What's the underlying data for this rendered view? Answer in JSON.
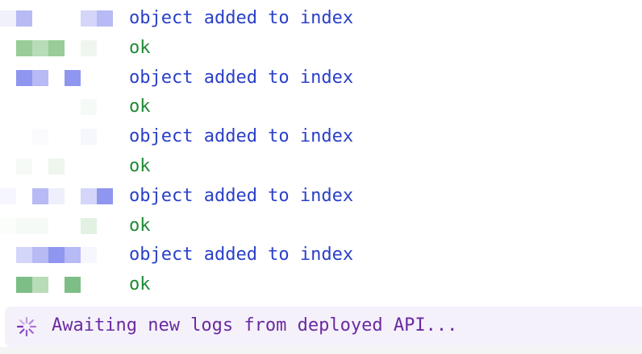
{
  "colors": {
    "message": "#2a40c8",
    "ok": "#1f8a34",
    "status_text": "#6a2aa0",
    "status_bg": "#f5f1fb",
    "spinner": "#7a33b8"
  },
  "log_lines": [
    {
      "text": "object added to index",
      "kind": "message",
      "blocks": [
        [
          "#f1f1fb",
          "#b7baf4",
          null,
          null,
          null,
          "#d3d6f8",
          "#b7baf4"
        ]
      ]
    },
    {
      "text": "ok",
      "kind": "ok",
      "blocks": [
        [
          null,
          "#98cc98",
          "#b7dcb7",
          "#98cc98",
          null,
          "#eef6ee",
          null
        ]
      ]
    },
    {
      "text": "object added to index",
      "kind": "message",
      "blocks": [
        [
          null,
          "#8f96ef",
          "#b7baf4",
          null,
          "#8f96ef",
          null,
          null
        ]
      ]
    },
    {
      "text": "ok",
      "kind": "ok",
      "blocks": [
        [
          null,
          null,
          null,
          null,
          null,
          "#f6faf6",
          null
        ]
      ]
    },
    {
      "text": "object added to index",
      "kind": "message",
      "blocks": [
        [
          null,
          null,
          "#fbfbfe",
          null,
          null,
          "#f6f6fe",
          null
        ]
      ]
    },
    {
      "text": "ok",
      "kind": "ok",
      "blocks": [
        [
          null,
          "#f6faf6",
          null,
          "#eef6ee",
          null,
          null,
          null
        ]
      ]
    },
    {
      "text": "object added to index",
      "kind": "message",
      "blocks": [
        [
          "#f6f6fe",
          null,
          "#b7baf4",
          "#eeeefc",
          null,
          "#d3d6f8",
          "#8f96ef"
        ]
      ]
    },
    {
      "text": "ok",
      "kind": "ok",
      "blocks": [
        [
          "#fbfdfb",
          "#f6faf6",
          "#f6faf6",
          null,
          null,
          "#e3f1e3",
          null
        ]
      ]
    },
    {
      "text": "object added to index",
      "kind": "message",
      "blocks": [
        [
          null,
          "#d3d6f8",
          "#b7baf4",
          "#8f96ef",
          "#b7baf4",
          "#f6f6fe",
          null
        ]
      ]
    },
    {
      "text": "ok",
      "kind": "ok",
      "blocks": [
        [
          null,
          "#7dbe87",
          "#b7dcb7",
          null,
          "#7dbe87",
          null,
          null
        ]
      ]
    }
  ],
  "status": {
    "text": "Awaiting new logs from deployed API...",
    "icon": "spinner-icon"
  }
}
